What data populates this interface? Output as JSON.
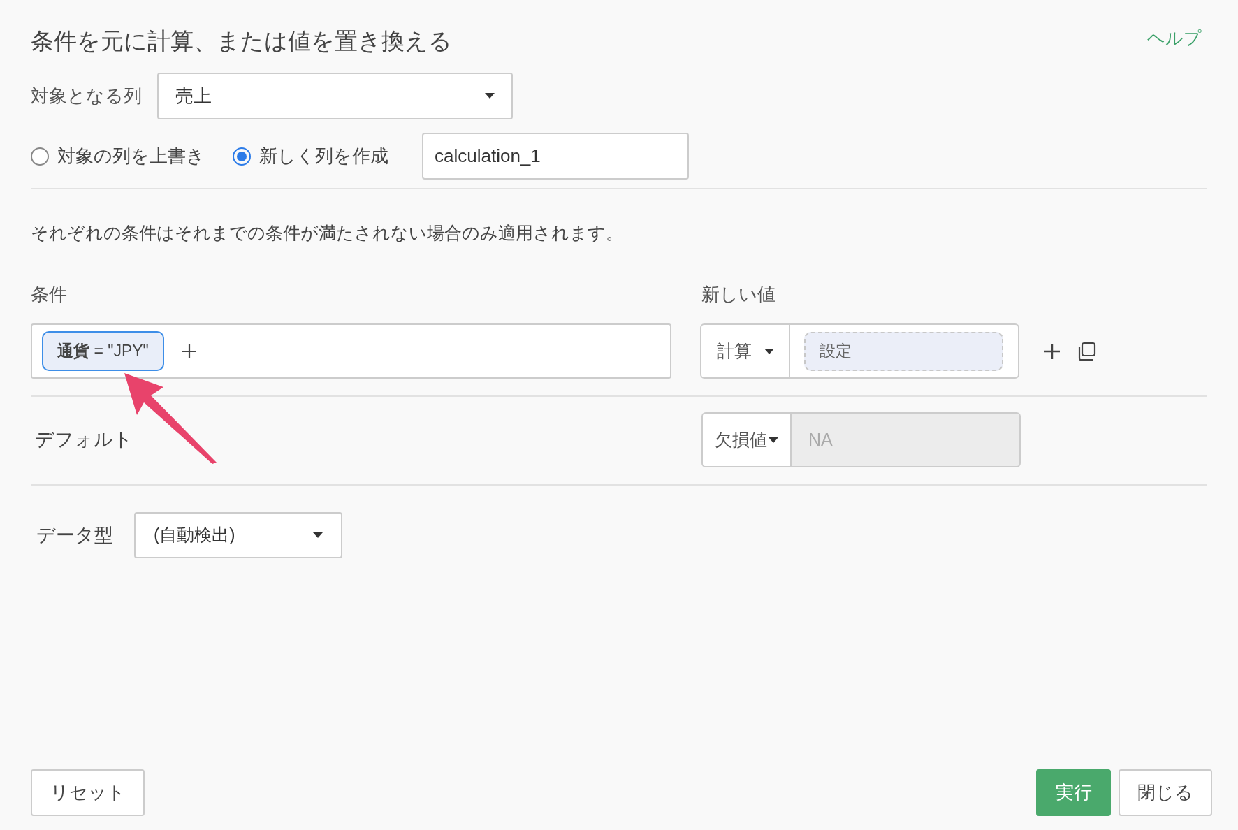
{
  "title": "条件を元に計算、または値を置き換える",
  "help_link": "ヘルプ",
  "target_column": {
    "label": "対象となる列",
    "value": "売上"
  },
  "output_mode": {
    "options": [
      {
        "label": "対象の列を上書き",
        "selected": false
      },
      {
        "label": "新しく列を作成",
        "selected": true
      }
    ],
    "new_column_name": "calculation_1"
  },
  "notice": "それぞれの条件はそれまでの条件が満たされない場合のみ適用されます。",
  "conditions": {
    "label": "条件",
    "value_label": "新しい値",
    "rows": [
      {
        "chips": [
          "**通貨** = \"JPY\""
        ],
        "value_type": "計算",
        "value_placeholder": "設定"
      }
    ]
  },
  "default": {
    "label": "デフォルト",
    "value_type": "欠損値",
    "value": "NA"
  },
  "data_type": {
    "label": "データ型",
    "value": "(自動検出)"
  },
  "buttons": {
    "reset": "リセット",
    "run": "実行",
    "close": "閉じる"
  }
}
